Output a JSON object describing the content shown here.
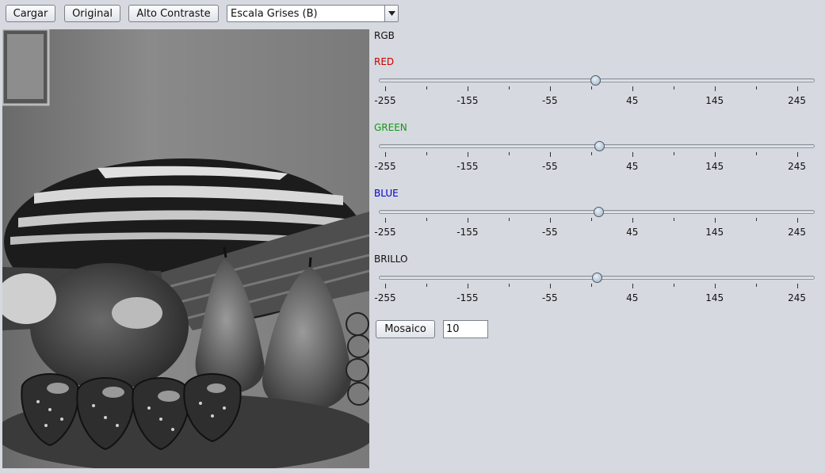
{
  "toolbar": {
    "load_label": "Cargar",
    "original_label": "Original",
    "contrast_label": "Alto Contraste",
    "filter_select": {
      "selected": "Escala Grises (B)"
    }
  },
  "colors": {
    "red": "#cc0000",
    "green": "#119911",
    "blue": "#0000cc",
    "window_bg": "#d6d9df"
  },
  "panel": {
    "rgb_label": "RGB",
    "tick_labels": [
      "-255",
      "-155",
      "-55",
      "45",
      "145",
      "245"
    ],
    "slider_range": [
      -255,
      255
    ],
    "sliders": [
      {
        "id": "red",
        "label": "RED",
        "value": 0
      },
      {
        "id": "green",
        "label": "GREEN",
        "value": 5
      },
      {
        "id": "blue",
        "label": "BLUE",
        "value": 4
      },
      {
        "id": "brillo",
        "label": "BRILLO",
        "value": 2
      }
    ],
    "mosaic": {
      "button_label": "Mosaico",
      "value": "10"
    }
  }
}
